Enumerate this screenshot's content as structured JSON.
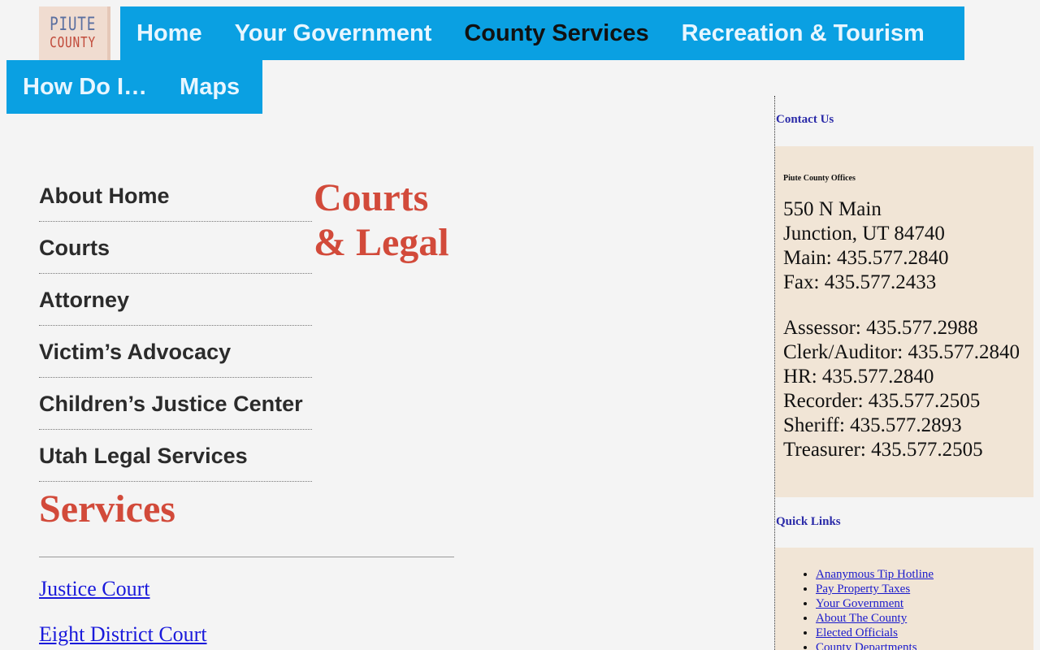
{
  "logo": {
    "line1": "PIUTE",
    "line2": "COUNTY"
  },
  "nav": {
    "row1": [
      "Home",
      "Your Government",
      "County Services",
      "Recreation & Tourism"
    ],
    "row2": [
      "How Do I…",
      "Maps"
    ],
    "active": "County Services"
  },
  "submenu": [
    "About Home",
    "Courts",
    "Attorney",
    "Victim’s Advocacy",
    "Children’s Justice Center",
    "Utah Legal Services"
  ],
  "page_title": {
    "line1": "Courts",
    "line2": "& Legal"
  },
  "services": {
    "heading": "Services",
    "links": [
      "Justice Court",
      "Eight District Court"
    ]
  },
  "sidebar": {
    "contact_heading": "Contact Us",
    "office_name": "Piute County Offices",
    "address": [
      "550 N Main",
      "Junction, UT 84740",
      "Main: 435.577.2840",
      "Fax: 435.577.2433"
    ],
    "phones": [
      "Assessor: 435.577.2988",
      "Clerk/Auditor: 435.577.2840",
      "HR: 435.577.2840",
      "Recorder: 435.577.2505",
      "Sheriff: 435.577.2893",
      "Treasurer: 435.577.2505"
    ],
    "quick_links_heading": "Quick Links",
    "quick_links": [
      "Ananymous Tip Hotline",
      "Pay Property Taxes",
      "Your Government",
      "About The County",
      "Elected Officials",
      "County Departments"
    ]
  },
  "colors": {
    "nav_bg": "#0aa0e2",
    "title_red": "#d24a3a",
    "sidebar_box": "#f1e5d6",
    "link_blue": "#1a1adb"
  }
}
